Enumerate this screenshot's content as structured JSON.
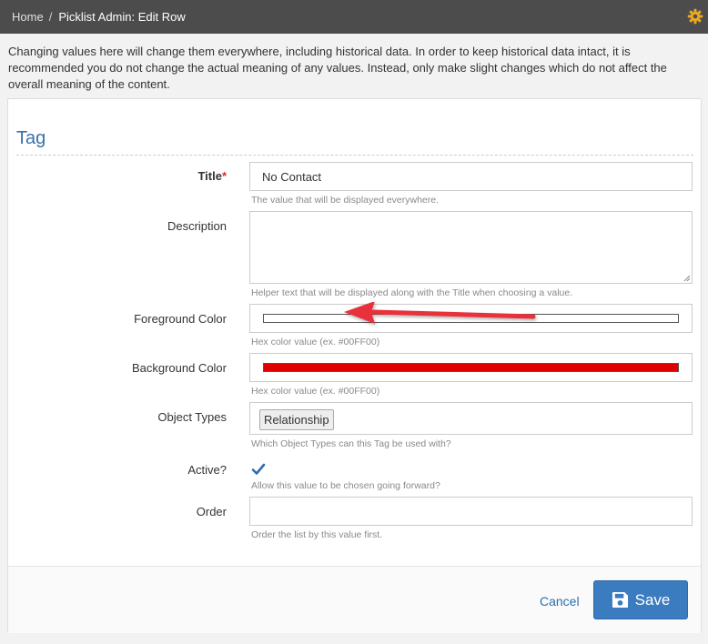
{
  "breadcrumb": {
    "home": "Home",
    "separator": "/",
    "current": "Picklist Admin: Edit Row"
  },
  "notice": "Changing values here will change them everywhere, including historical data. In order to keep historical data intact, it is recommended you do not change the actual meaning of any values. Instead, only make slight changes which do not affect the overall meaning of the content.",
  "form": {
    "section_title": "Tag",
    "title": {
      "label": "Title",
      "required_mark": "*",
      "value": "No Contact",
      "help": "The value that will be displayed everywhere."
    },
    "description": {
      "label": "Description",
      "value": "",
      "help": "Helper text that will be displayed along with the Title when choosing a value."
    },
    "foreground_color": {
      "label": "Foreground Color",
      "color": "#FFFFFF",
      "help": "Hex color value (ex. #00FF00)"
    },
    "background_color": {
      "label": "Background Color",
      "color": "#E00000",
      "help": "Hex color value (ex. #00FF00)"
    },
    "object_types": {
      "label": "Object Types",
      "chips": [
        "Relationship"
      ],
      "help": "Which Object Types can this Tag be used with?"
    },
    "active": {
      "label": "Active?",
      "checked": true,
      "help": "Allow this value to be chosen going forward?"
    },
    "order": {
      "label": "Order",
      "value": "",
      "help": "Order the list by this value first."
    }
  },
  "actions": {
    "cancel": "Cancel",
    "save": "Save"
  },
  "colors": {
    "accent": "#3b7bbf",
    "topbar": "#4c4c4c",
    "arrow": "#e8323b"
  }
}
